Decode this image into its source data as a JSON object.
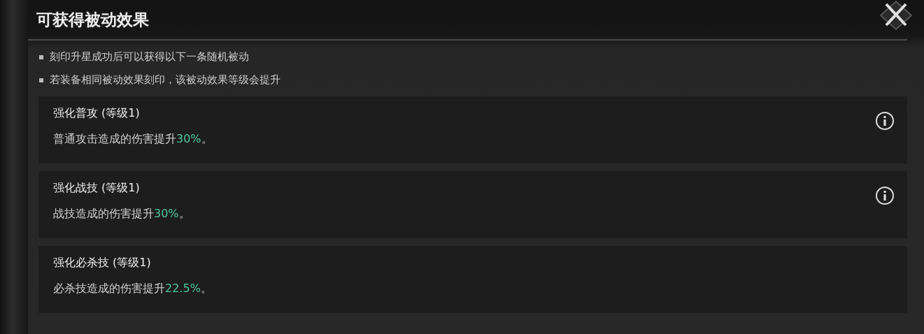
{
  "title": "可获得被动效果",
  "notes": [
    "刻印升星成功后可以获得以下一条随机被动",
    "若装备相同被动效果刻印，该被动效果等级会提升"
  ],
  "effects": [
    {
      "name": "强化普攻 (等级1)",
      "text": "普通攻击造成的伤害提升",
      "value": "30%",
      "end": "。",
      "info": true
    },
    {
      "name": "强化战技 (等级1)",
      "text": "战技造成的伤害提升",
      "value": "30%",
      "end": "。",
      "info": true
    },
    {
      "name": "强化必杀技 (等级1)",
      "text": "必杀技造成的伤害提升",
      "value": "22.5%",
      "end": "。",
      "info": false
    }
  ]
}
